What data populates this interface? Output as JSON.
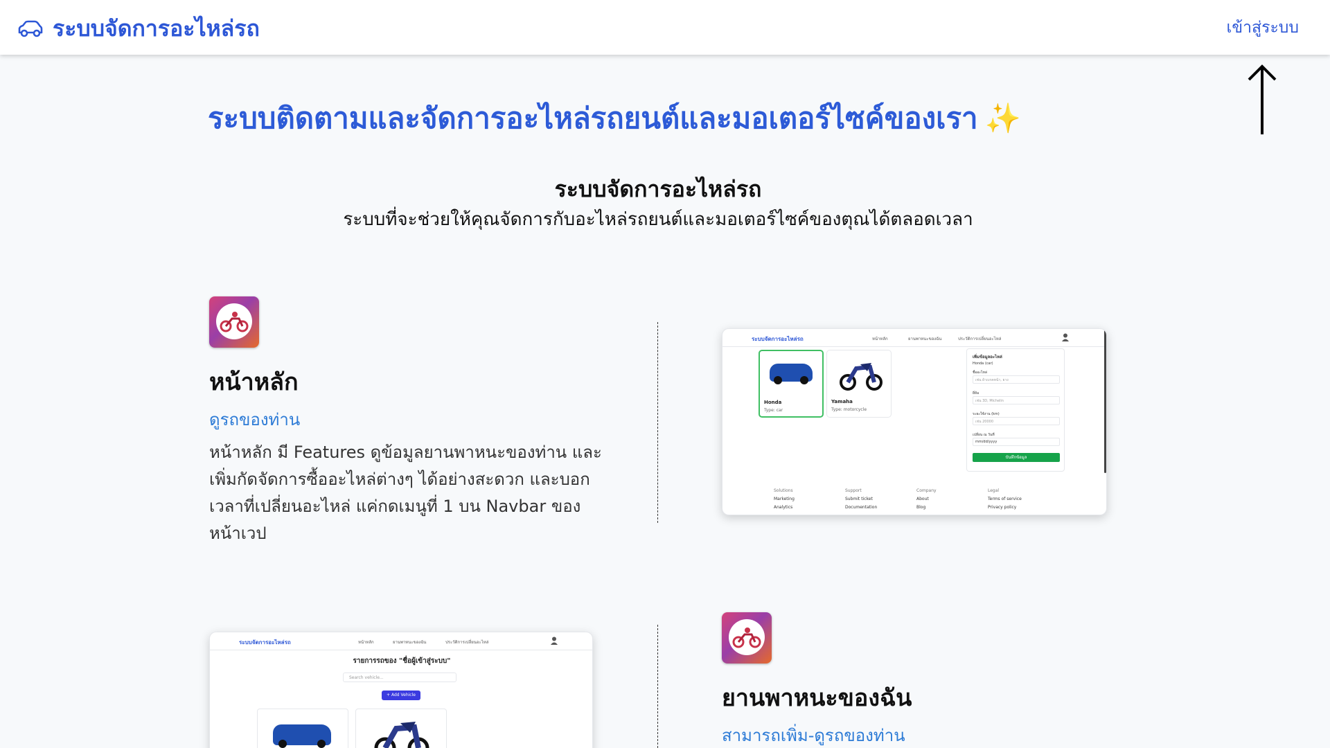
{
  "navbar": {
    "brand": "ระบบจัดการอะไหล่รถ",
    "brand_icon": "car-icon",
    "login": "เข้าสู่ระบบ"
  },
  "hero": {
    "title": "ระบบติดตามและจัดการอะไหล่รถยนต์และมอเตอร์ไซค์ของเรา",
    "emoji": "✨"
  },
  "intro": {
    "heading": "ระบบจัดการอะไหล่รถ",
    "subheading": "ระบบที่จะช่วยให้คุณจัดการกับอะไหล่รถยนต์และมอเตอร์ไซค์ของตุณได้ตลอดเวลา"
  },
  "features": [
    {
      "title": "หน้าหลัก",
      "subtitle": "ดูรถของท่าน",
      "description": "หน้าหลัก มี Features ดูข้อมูลยานพาหนะของท่าน และเพิ่มกัดจัดการซื้ออะไหล่ต่างๆ ได้อย่างสะดวก และบอกเวลาที่เปลี่ยนอะไหล่ แค่กดเมนูที่ 1 บน Navbar ของหน้าเวป"
    },
    {
      "title": "ยานพาหนะของฉัน",
      "subtitle": "สามารถเพิ่ม-ดูรถของท่าน"
    }
  ],
  "screenshot1": {
    "brand": "ระบบจัดการอะไหล่รถ",
    "nav": [
      "หน้าหลัก",
      "ยานพาหนะของฉัน",
      "ประวัติการเปลี่ยนอะไหล่"
    ],
    "cards": [
      {
        "name": "Honda",
        "type": "Type: car"
      },
      {
        "name": "Yamaha",
        "type": "Type: motorcycle"
      }
    ],
    "form": {
      "title": "เพิ่มข้อมูลอะไหล่",
      "vehicle": "Honda (car)",
      "fields": [
        {
          "label": "ชื่ออะไหล่",
          "placeholder": "เช่น ผ้าเบรคหน้า, ยาง"
        },
        {
          "label": "ยี่ห้อ",
          "placeholder": "เช่น 3D, Michelin"
        },
        {
          "label": "ระยะใช้งาน (km)",
          "placeholder": "เช่น 20000"
        },
        {
          "label": "เปลี่ยน ณ วันที่",
          "placeholder": "mm/dd/yyyy"
        }
      ],
      "save": "บันทึกข้อมูล"
    },
    "footer": [
      {
        "head": "Solutions",
        "items": [
          "Marketing",
          "Analytics"
        ]
      },
      {
        "head": "Support",
        "items": [
          "Submit ticket",
          "Documentation"
        ]
      },
      {
        "head": "Company",
        "items": [
          "About",
          "Blog"
        ]
      },
      {
        "head": "Legal",
        "items": [
          "Terms of service",
          "Privacy policy"
        ]
      }
    ]
  },
  "screenshot2": {
    "brand": "ระบบจัดการอะไหล่รถ",
    "nav": [
      "หน้าหลัก",
      "ยานพาหนะของฉัน",
      "ประวัติการเปลี่ยนอะไหล่"
    ],
    "title": "รายการรถของ \"ชื่อผู้เข้าสู่ระบบ\"",
    "search_placeholder": "Search vehicle...",
    "add_button": "+ Add Vehicle"
  },
  "colors": {
    "brand": "#2d57d6",
    "accent_gold": "#f5b324",
    "save_green": "#16a34a"
  }
}
